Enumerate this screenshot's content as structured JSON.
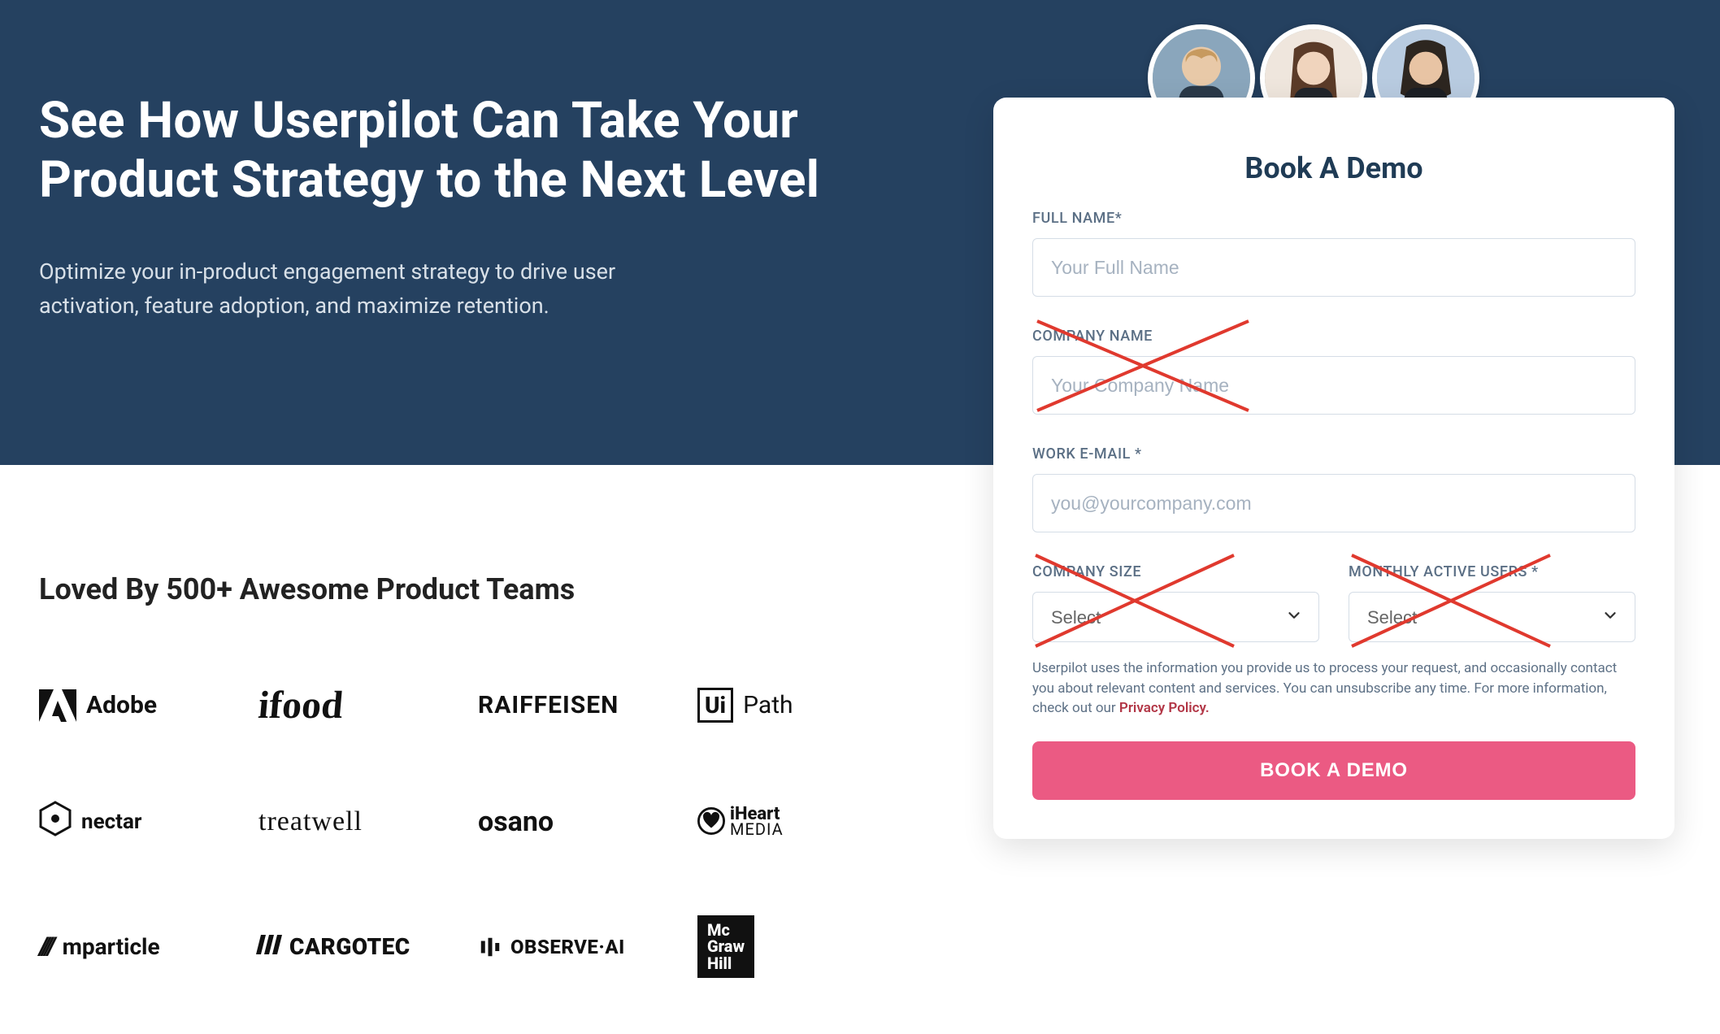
{
  "hero": {
    "title": "See How Userpilot Can Take Your Product Strategy to the Next Level",
    "subtitle": "Optimize your in-product engagement strategy to drive user activation, feature adoption, and maximize retention."
  },
  "social_proof": {
    "heading": "Loved By 500+ Awesome Product Teams",
    "logos": [
      "Adobe",
      "ifood",
      "RAIFFEISEN",
      "UiPath",
      "nectar",
      "treatwell",
      "osano",
      "iHeart MEDIA",
      "mparticle",
      "CARGOTEC",
      "OBSERVE·AI",
      "McGraw Hill"
    ]
  },
  "form": {
    "title": "Book A Demo",
    "fields": {
      "full_name": {
        "label": "FULL NAME*",
        "placeholder": "Your Full Name"
      },
      "company_name": {
        "label": "COMPANY NAME",
        "placeholder": "Your Company Name"
      },
      "work_email": {
        "label": "WORK E-MAIL *",
        "placeholder": "you@yourcompany.com"
      },
      "company_size": {
        "label": "COMPANY SIZE",
        "placeholder": "Select"
      },
      "monthly_active_users": {
        "label": "MONTHLY ACTIVE USERS *",
        "placeholder": "Select"
      }
    },
    "disclosure_prefix": "Userpilot uses the information you provide us to process your request, and occasionally contact you about relevant content and services. You can unsubscribe any time. For more information, check out our ",
    "disclosure_link_text": "Privacy Policy.",
    "cta": "BOOK A DEMO"
  }
}
